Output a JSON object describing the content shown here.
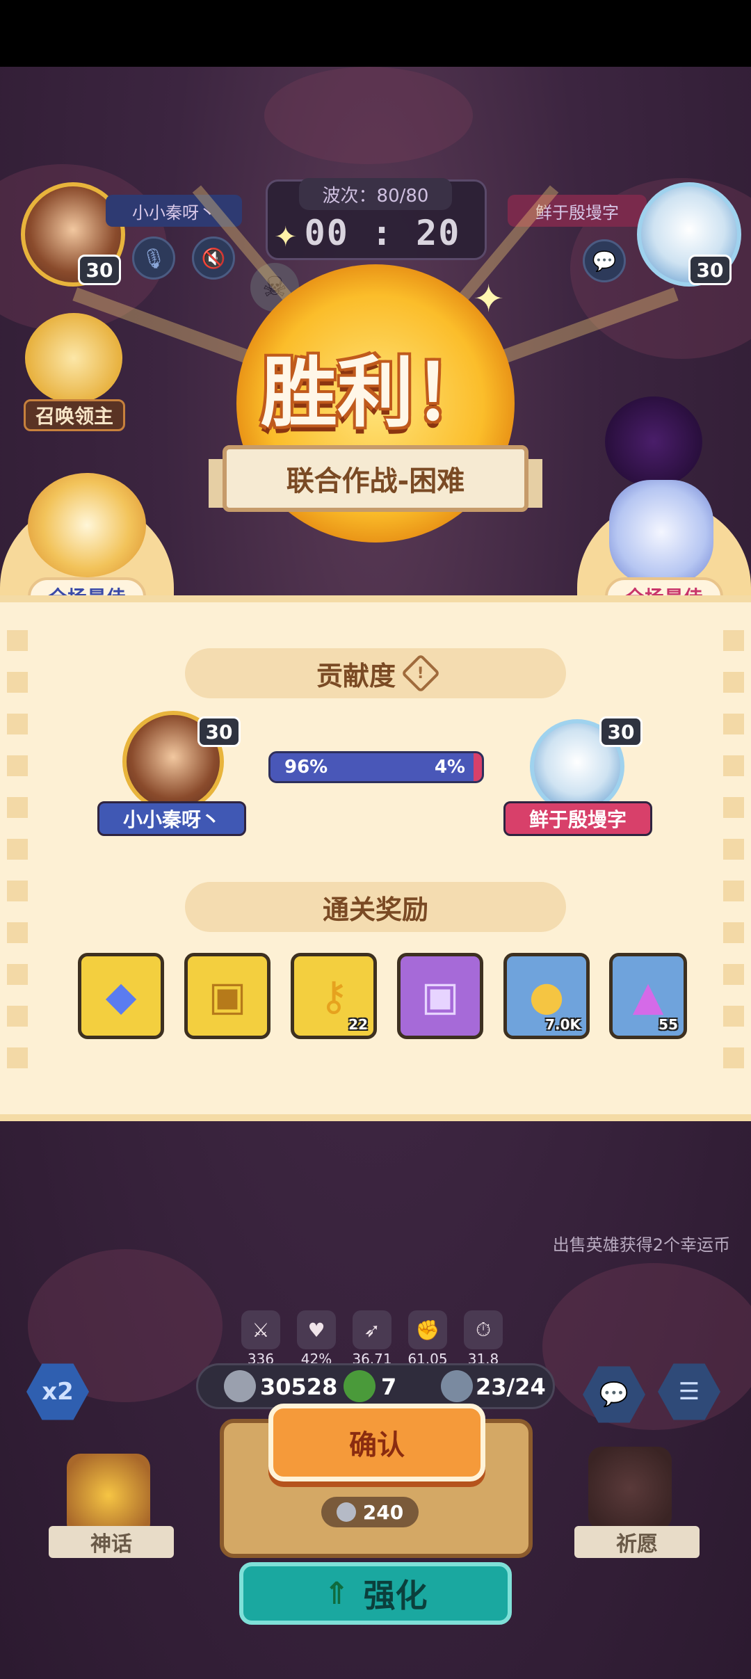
{
  "hud": {
    "my_name": "小小秦呀丶",
    "my_level": "30",
    "opponent_name": "鲜于殷墁字",
    "opponent_level": "30",
    "wave_label": "波次：80/80",
    "timer": "00 : 20",
    "summon_lord": "召唤领主"
  },
  "result": {
    "title": "胜利！",
    "mode": "联合作战-困难",
    "mvp_label": "全场最佳"
  },
  "contribution": {
    "title": "贡献度",
    "my_name": "小小秦呀丶",
    "my_level": "30",
    "my_percent": "96%",
    "my_fraction": 0.96,
    "opp_name": "鲜于殷墁字",
    "opp_level": "30",
    "opp_percent": "4%"
  },
  "rewards": {
    "title": "通关奖励",
    "items": [
      {
        "icon": "crystal-icon",
        "qty": ""
      },
      {
        "icon": "gold-chest-icon",
        "qty": ""
      },
      {
        "icon": "key-icon",
        "qty": "22"
      },
      {
        "icon": "purple-chest-icon",
        "qty": ""
      },
      {
        "icon": "coin-icon",
        "qty": "7.0K"
      },
      {
        "icon": "ore-icon",
        "qty": "55"
      }
    ]
  },
  "bottom": {
    "hint": "出售英雄获得2个幸运币",
    "stats": [
      "336",
      "42%",
      "36.71",
      "61.05",
      "31.8"
    ],
    "silver": "30528",
    "clover": "7",
    "units": "23/24",
    "speed": "x2",
    "confirm": "确认",
    "cost": "240",
    "strengthen": "强化",
    "myth": "神话",
    "wish": "祈愿"
  },
  "colors": {
    "accent_orange": "#f59a3a",
    "blue_bar": "#4957b8",
    "pink_bar": "#d8406a",
    "panel": "#fdf0d4"
  }
}
